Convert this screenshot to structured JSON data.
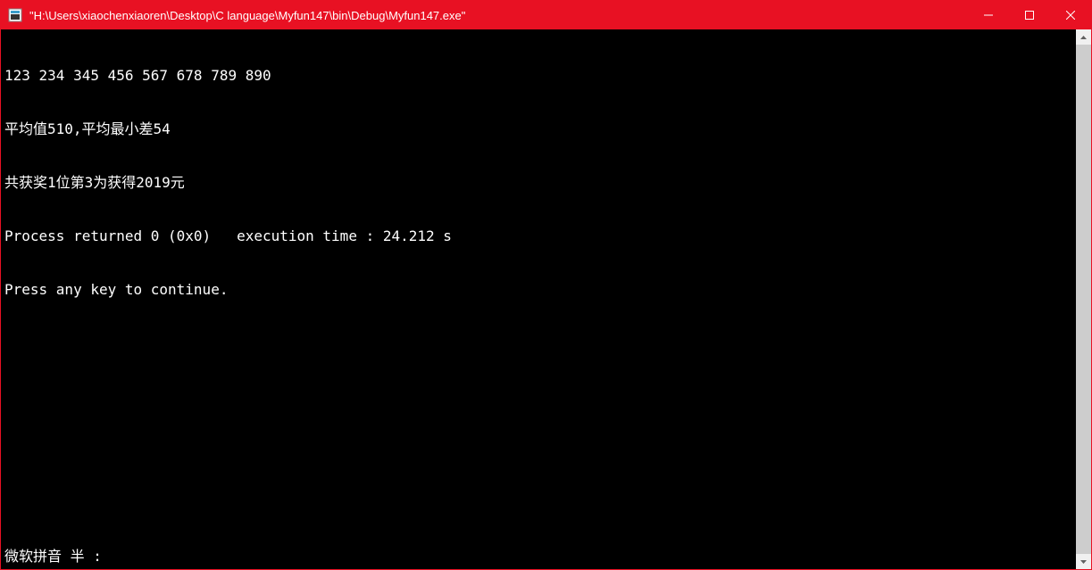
{
  "titlebar": {
    "title": "\"H:\\Users\\xiaochenxiaoren\\Desktop\\C language\\Myfun147\\bin\\Debug\\Myfun147.exe\""
  },
  "console": {
    "lines": [
      "123 234 345 456 567 678 789 890",
      "平均值510,平均最小差54",
      "共获奖1位第3为获得2019元",
      "Process returned 0 (0x0)   execution time : 24.212 s",
      "Press any key to continue."
    ],
    "ime_status": "微软拼音 半 :"
  },
  "colors": {
    "titlebar_bg": "#e81123",
    "console_bg": "#000000",
    "console_fg": "#ffffff"
  }
}
